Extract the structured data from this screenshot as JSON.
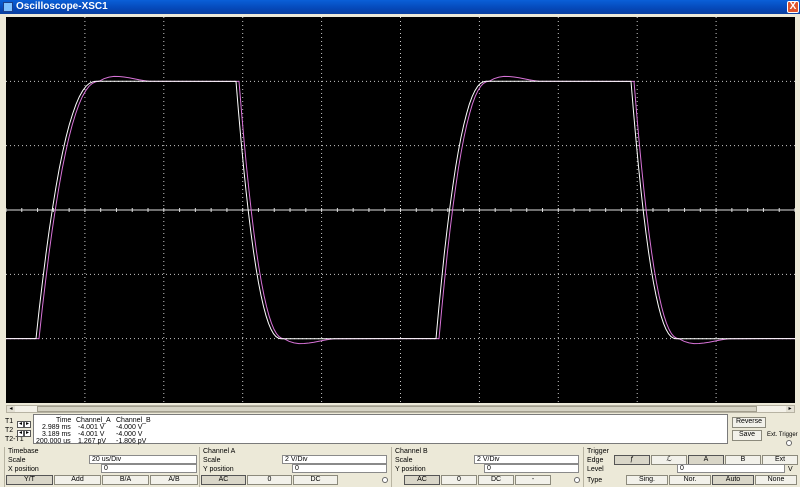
{
  "window": {
    "title": "Oscilloscope-XSC1",
    "close_glyph": "X"
  },
  "readout": {
    "headers": [
      "Time",
      "Channel_A",
      "Channel_B"
    ],
    "rows": [
      {
        "label": "T1",
        "time": "2.989 ms",
        "a": "-4.001 V",
        "b": "-4.000 V"
      },
      {
        "label": "T2",
        "time": "3.189 ms",
        "a": "-4.001 V",
        "b": "-4.000 V"
      },
      {
        "label": "T2-T1",
        "time": "200.000 us",
        "a": "1.267 pV",
        "b": "-1.806 pV"
      }
    ]
  },
  "side_buttons": {
    "reverse": "Reverse",
    "save": "Save",
    "ext_trigger": "Ext. Trigger"
  },
  "timebase": {
    "title": "Timebase",
    "scale_label": "Scale",
    "scale_value": "20 us/Div",
    "xpos_label": "X position",
    "xpos_value": "0",
    "modes": [
      "Y/T",
      "Add",
      "B/A",
      "A/B"
    ]
  },
  "channel_a": {
    "title": "Channel A",
    "scale_label": "Scale",
    "scale_value": "2  V/Div",
    "ypos_label": "Y position",
    "ypos_value": "0",
    "coupling": [
      "AC",
      "0",
      "DC"
    ]
  },
  "channel_b": {
    "title": "Channel B",
    "scale_label": "Scale",
    "scale_value": "2  V/Div",
    "ypos_label": "Y position",
    "ypos_value": "0",
    "coupling": [
      "AC",
      "0",
      "DC",
      "-"
    ]
  },
  "trigger": {
    "title": "Trigger",
    "edge_label": "Edge",
    "edges": [
      "ƒ",
      "ℒ",
      "A",
      "B",
      "Ext"
    ],
    "level_label": "Level",
    "level_value": "0",
    "level_unit": "V",
    "type_label": "Type",
    "types": [
      "Sing.",
      "Nor.",
      "Auto",
      "None"
    ]
  },
  "trace_colors": {
    "channel_a": "#ffffff",
    "channel_b": "#d873d8",
    "grid": "#c8c8c8"
  }
}
